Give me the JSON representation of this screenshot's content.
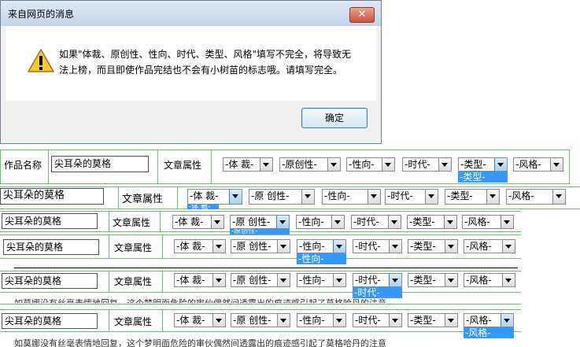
{
  "dialog": {
    "title": "来自网页的消息",
    "close_glyph": "✕",
    "message_line1": "如果\"体裁、原创性、性向、时代、类型、风格\"填写不完全，将导致无",
    "message_line2": "法上榜，而且即使作品完结也不会有小树苗的标志哦。请填写完全。",
    "ok_label": "确定"
  },
  "rows": [
    {
      "label": "作品名称",
      "title": "尖耳朵的莫格",
      "attr_label": "文章属性",
      "selects": [
        "-体 裁-",
        "-原创性-",
        "-性向-",
        "-时代-",
        "-类型-",
        "-风格-"
      ],
      "open_option": "-类型-"
    },
    {
      "title": "尖耳朵的莫格",
      "attr_label": "文章属性",
      "selects": [
        "-体 裁-",
        "-原 创性-",
        "-性向-",
        "-时代-",
        "-类型-",
        "-风格-"
      ],
      "open_option": "-体 裁-"
    },
    {
      "title": "尖耳朵的莫格",
      "attr_label": "文章属性",
      "selects": [
        "-体 裁-",
        "-原 创性-",
        "-性向-",
        "-时代-",
        "-类型-",
        "-风格-"
      ],
      "open_option": "-原创性-"
    },
    {
      "title": "尖耳朵的莫格",
      "attr_label": "文章属性",
      "selects": [
        "-体 裁-",
        "-原 创性-",
        "-性向-",
        "-时代-",
        "-类型-",
        "-风格-"
      ],
      "open_option": "-性向-"
    },
    {
      "title": "尖耳朵的莫格",
      "attr_label": "文章属性",
      "selects": [
        "-体 裁-",
        "-原 创性-",
        "-性向-",
        "-时代-",
        "-类型-",
        "-风格-"
      ],
      "open_option": "-时代-"
    },
    {
      "title": "尖耳朵的莫格",
      "attr_label": "文章属性",
      "selects": [
        "-体 裁-",
        "-原 创性-",
        "-性向-",
        "-时代-",
        "-类型-",
        "-风格-"
      ],
      "open_option": "-风格-"
    }
  ],
  "bottom_text": "如莫娜没有丝毫表情地回复，这个梦明面危险的审伙偶然间透露出的痕迹感引起了莫格哈丹的注意"
}
